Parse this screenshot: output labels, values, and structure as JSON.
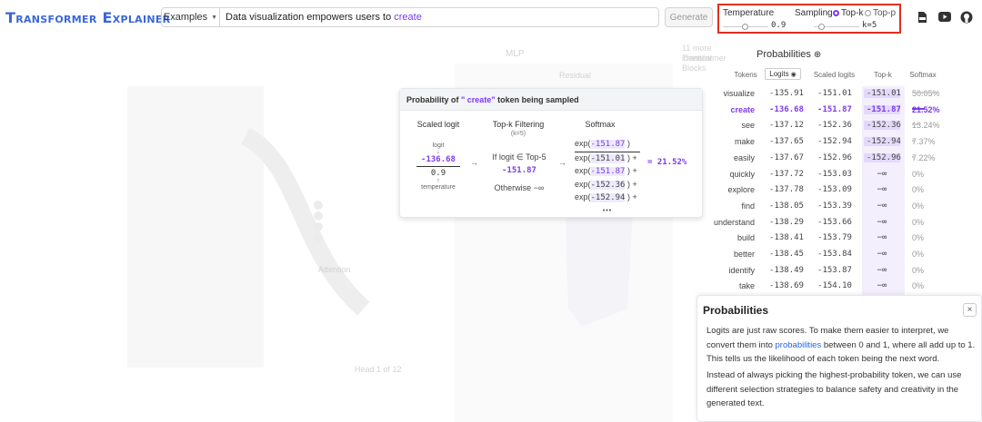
{
  "header": {
    "logo": "Transformer Explainer",
    "examples_label": "Examples",
    "prompt_text": "Data visualization empowers users to",
    "prompt_highlight": "create",
    "generate_label": "Generate"
  },
  "sampling": {
    "temperature_label": "Temperature",
    "temperature_value": "0.9",
    "sampling_label": "Sampling",
    "topk_label": "Top-k",
    "topp_label": "Top-p",
    "k_value": "k=5",
    "temperature_level": 0.45,
    "k_level": 0.1
  },
  "background": {
    "mlp": "MLP",
    "blocks_note_1": "11 more identical",
    "blocks_note_2": "Transformer",
    "blocks_note_3": "Blocks",
    "attention": "Attention",
    "residual": "Residual",
    "head_pager": "Head 1 of 12"
  },
  "card": {
    "title_prefix": "Probability of",
    "title_token": "\" create\"",
    "title_suffix": "token being sampled",
    "col1_title": "Scaled logit",
    "col1_logit_label": "logit",
    "col1_logit_value": "-136.68",
    "col1_temp_value": "0.9",
    "col1_temp_label": "temperature",
    "col2_title": "Top-k Filtering",
    "col2_sub": "(k=5)",
    "col2_if": "If logit ∈ Top-5",
    "col2_value": "-151.87",
    "col2_otherwise": "Otherwise −∞",
    "col3_title": "Softmax",
    "col3_numerator": "-151.87",
    "col3_terms": [
      "-151.01",
      "-151.87",
      "-152.36",
      "-152.94"
    ],
    "col3_dots": "•••",
    "result": "= 21.52%",
    "arrow": "→"
  },
  "probs": {
    "title": "Probabilities",
    "col_tokens": "Tokens",
    "col_logits": "Logits",
    "col_scaled": "Scaled logits",
    "col_topk": "Top-k",
    "col_softmax": "Softmax",
    "rows": [
      {
        "token": "visualize",
        "logit": "-135.91",
        "scaled": "-151.01",
        "topk": "-151.01",
        "softmax": "50.05%",
        "p": 0.5005
      },
      {
        "token": "create",
        "logit": "-136.68",
        "scaled": "-151.87",
        "topk": "-151.87",
        "softmax": "21.52%",
        "p": 0.2152
      },
      {
        "token": "see",
        "logit": "-137.12",
        "scaled": "-152.36",
        "topk": "-152.36",
        "softmax": "13.24%",
        "p": 0.1324
      },
      {
        "token": "make",
        "logit": "-137.65",
        "scaled": "-152.94",
        "topk": "-152.94",
        "softmax": "7.37%",
        "p": 0.0737
      },
      {
        "token": "easily",
        "logit": "-137.67",
        "scaled": "-152.96",
        "topk": "-152.96",
        "softmax": "7.22%",
        "p": 0.0722
      },
      {
        "token": "quickly",
        "logit": "-137.72",
        "scaled": "-153.03",
        "topk": "−∞",
        "softmax": "0%",
        "p": 0
      },
      {
        "token": "explore",
        "logit": "-137.78",
        "scaled": "-153.09",
        "topk": "−∞",
        "softmax": "0%",
        "p": 0
      },
      {
        "token": "find",
        "logit": "-138.05",
        "scaled": "-153.39",
        "topk": "−∞",
        "softmax": "0%",
        "p": 0
      },
      {
        "token": "understand",
        "logit": "-138.29",
        "scaled": "-153.66",
        "topk": "−∞",
        "softmax": "0%",
        "p": 0
      },
      {
        "token": "build",
        "logit": "-138.41",
        "scaled": "-153.79",
        "topk": "−∞",
        "softmax": "0%",
        "p": 0
      },
      {
        "token": "better",
        "logit": "-138.45",
        "scaled": "-153.84",
        "topk": "−∞",
        "softmax": "0%",
        "p": 0
      },
      {
        "token": "identify",
        "logit": "-138.49",
        "scaled": "-153.87",
        "topk": "−∞",
        "softmax": "0%",
        "p": 0
      },
      {
        "token": "take",
        "logit": "-138.69",
        "scaled": "-154.10",
        "topk": "−∞",
        "softmax": "0%",
        "p": 0
      }
    ]
  },
  "explain": {
    "title": "Probabilities",
    "close": "×",
    "p1_a": "Logits are just raw scores. To make them easier to interpret, we convert them into",
    "p1_link": "probabilities",
    "p1_b": "between 0 and 1, where all add up to 1. This tells us the likelihood of each token being the next word.",
    "p2": "Instead of always picking the highest-probability token, we can use different selection strategies to balance safety and creativity in the generated text."
  },
  "colors": {
    "accent": "#7c3aed",
    "brand": "#3a66d8",
    "highlight_border": "#e0301e"
  }
}
